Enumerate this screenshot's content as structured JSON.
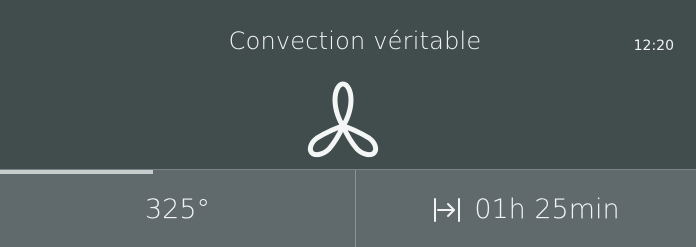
{
  "header": {
    "mode_title": "Convection véritable",
    "clock": "12:20"
  },
  "mode_icon": "fan-icon",
  "progress": {
    "fraction": 0.22
  },
  "controls": {
    "temperature": "325°",
    "timer_icon": "cook-time-icon",
    "cook_time": "01h 25min"
  },
  "colors": {
    "background": "#414c4d",
    "bottom_bar": "#606a6c",
    "progress_fill": "#c7cccd",
    "text": "#f2f4f4"
  }
}
